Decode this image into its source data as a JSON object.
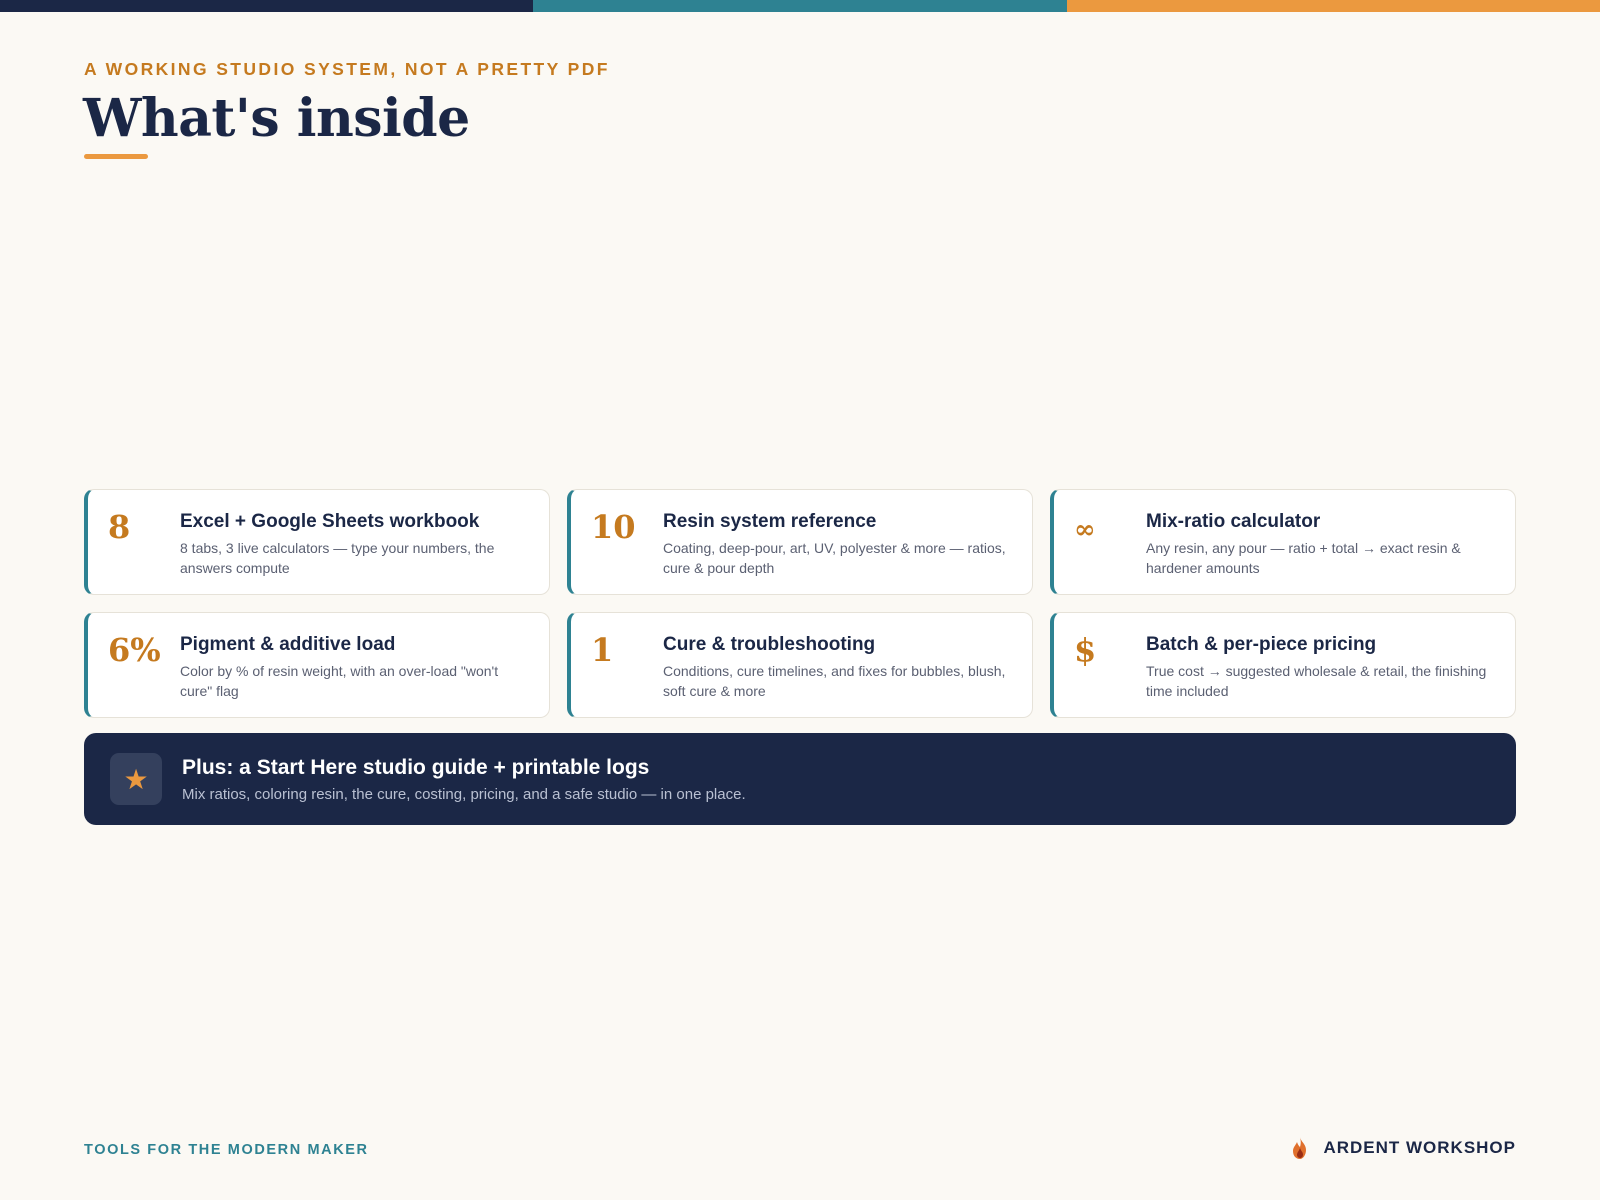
{
  "header": {
    "eyebrow": "A WORKING STUDIO SYSTEM, NOT A PRETTY PDF",
    "title": "What's inside"
  },
  "colors": {
    "navy": "#1b2746",
    "teal": "#2e8292",
    "orange": "#eb993f",
    "accent_text": "#c57a1f",
    "background": "#fbf9f4"
  },
  "cards": [
    {
      "stat": "8",
      "title": "Excel + Google Sheets workbook",
      "desc": "8 tabs, 3 live calculators — type your numbers, the answers compute"
    },
    {
      "stat": "10",
      "title": "Resin system reference",
      "desc": "Coating, deep-pour, art, UV, polyester & more — ratios, cure & pour depth"
    },
    {
      "stat": "∞",
      "title": "Mix-ratio calculator",
      "desc": "Any resin, any pour — ratio + total → exact resin & hardener amounts"
    },
    {
      "stat": "6%",
      "title": "Pigment & additive load",
      "desc": "Color by % of resin weight, with an over-load \"won't cure\" flag"
    },
    {
      "stat": "1",
      "title": "Cure & troubleshooting",
      "desc": "Conditions, cure timelines, and fixes for bubbles, blush, soft cure & more"
    },
    {
      "stat": "$",
      "title": "Batch & per-piece pricing",
      "desc": "True cost → suggested wholesale & retail, the finishing time included"
    }
  ],
  "banner": {
    "icon": "star-icon",
    "icon_glyph": "★",
    "title": "Plus: a Start Here studio guide + printable logs",
    "desc": "Mix ratios, coloring resin, the cure, costing, pricing, and a safe studio — in one place."
  },
  "footer": {
    "tagline": "TOOLS FOR THE MODERN MAKER",
    "brand_icon": "flame-icon",
    "brand": "ARDENT WORKSHOP"
  }
}
